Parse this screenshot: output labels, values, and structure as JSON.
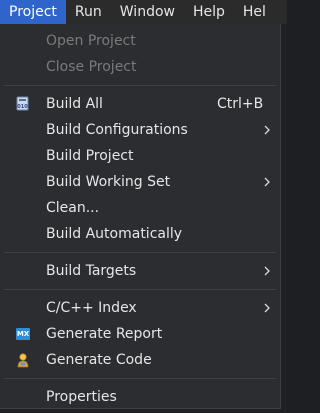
{
  "menubar": {
    "items": [
      {
        "label": "Project"
      },
      {
        "label": "Run"
      },
      {
        "label": "Window"
      },
      {
        "label": "Help"
      },
      {
        "label": "Hel"
      }
    ]
  },
  "menu": {
    "open_project": "Open Project",
    "close_project": "Close Project",
    "build_all": "Build All",
    "build_all_shortcut": "Ctrl+B",
    "build_configurations": "Build Configurations",
    "build_project": "Build Project",
    "build_working_set": "Build Working Set",
    "clean": "Clean...",
    "build_automatically": "Build Automatically",
    "build_targets": "Build Targets",
    "cpp_index": "C/C++ Index",
    "generate_report": "Generate Report",
    "generate_code": "Generate Code",
    "properties": "Properties",
    "mx_icon_text": "MX"
  },
  "colors": {
    "menu_bg": "#2b2d30",
    "active_menu": "#2f65ca",
    "text": "#e6e6e6",
    "disabled_text": "#7a7a7a"
  }
}
